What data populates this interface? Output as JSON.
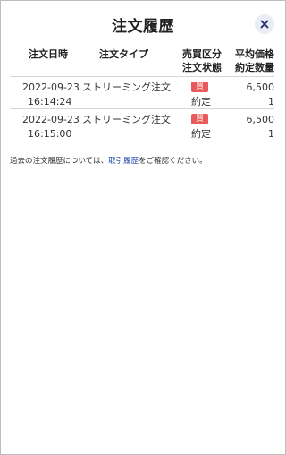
{
  "dialog": {
    "title": "注文履歴",
    "close_icon": "close-icon"
  },
  "table": {
    "headers": {
      "date": "注文日時",
      "type": "注文タイプ",
      "side": "売買区分",
      "status": "注文状態",
      "price": "平均価格",
      "quantity": "約定数量"
    },
    "rows": [
      {
        "date": "2022-09-23",
        "time": "16:14:24",
        "type": "ストリーミング注文",
        "side": "買",
        "status": "約定",
        "price": "6,500",
        "quantity": "1"
      },
      {
        "date": "2022-09-23",
        "time": "16:15:00",
        "type": "ストリーミング注文",
        "side": "買",
        "status": "約定",
        "price": "6,500",
        "quantity": "1"
      }
    ]
  },
  "footer_note": {
    "prefix": "過去の注文履歴については、",
    "link": "取引履歴",
    "suffix": "をご確認ください。"
  },
  "colors": {
    "buy_badge": "#ea5a5a",
    "link": "#2244aa",
    "close_button_bg": "#e9edf6",
    "close_icon": "#1f2a6b"
  }
}
